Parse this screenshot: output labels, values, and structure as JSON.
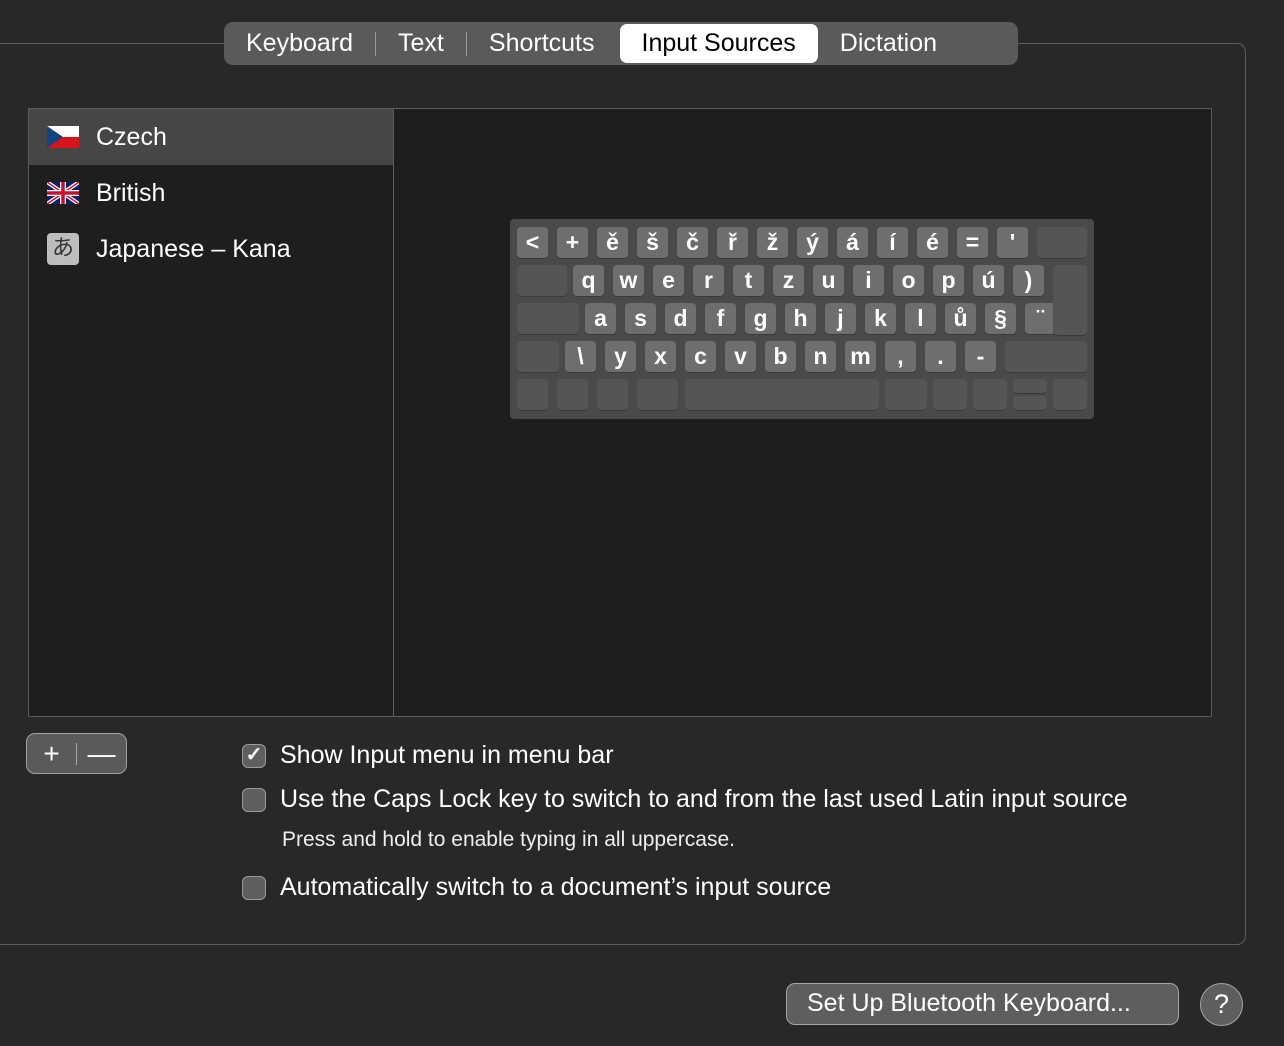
{
  "tabs": [
    {
      "label": "Keyboard"
    },
    {
      "label": "Text"
    },
    {
      "label": "Shortcuts"
    },
    {
      "label": "Input Sources",
      "selected": true
    },
    {
      "label": "Dictation"
    }
  ],
  "sources": [
    {
      "label": "Czech",
      "icon": "czech-flag-icon",
      "selected": true
    },
    {
      "label": "British",
      "icon": "uk-flag-icon"
    },
    {
      "label": "Japanese – Kana",
      "icon": "kana-icon",
      "glyph": "あ"
    }
  ],
  "keyboard": {
    "rows": [
      [
        "<",
        "+",
        "ě",
        "š",
        "č",
        "ř",
        "ž",
        "ý",
        "á",
        "í",
        "é",
        "=",
        "'"
      ],
      [
        "q",
        "w",
        "e",
        "r",
        "t",
        "z",
        "u",
        "i",
        "o",
        "p",
        "ú",
        ")"
      ],
      [
        "a",
        "s",
        "d",
        "f",
        "g",
        "h",
        "j",
        "k",
        "l",
        "ů",
        "§",
        "¨"
      ],
      [
        "\\",
        "y",
        "x",
        "c",
        "v",
        "b",
        "n",
        "m",
        ",",
        ".",
        "-"
      ]
    ]
  },
  "add_button": "+",
  "remove_button": "—",
  "options": [
    {
      "label": "Show Input menu in menu bar",
      "checked": true
    },
    {
      "label": "Use the Caps Lock key to switch to and from the last used Latin input source",
      "checked": false,
      "hint": "Press and hold to enable typing in all uppercase."
    },
    {
      "label": "Automatically switch to a document’s input source",
      "checked": false
    }
  ],
  "check_glyph": "✓",
  "bluetooth_button": "Set Up Bluetooth Keyboard...",
  "help_button": "?",
  "colors": {
    "background": "#282828",
    "list": "#1e1e1e",
    "selected_row": "#464646",
    "key": "#6e6e6e"
  }
}
